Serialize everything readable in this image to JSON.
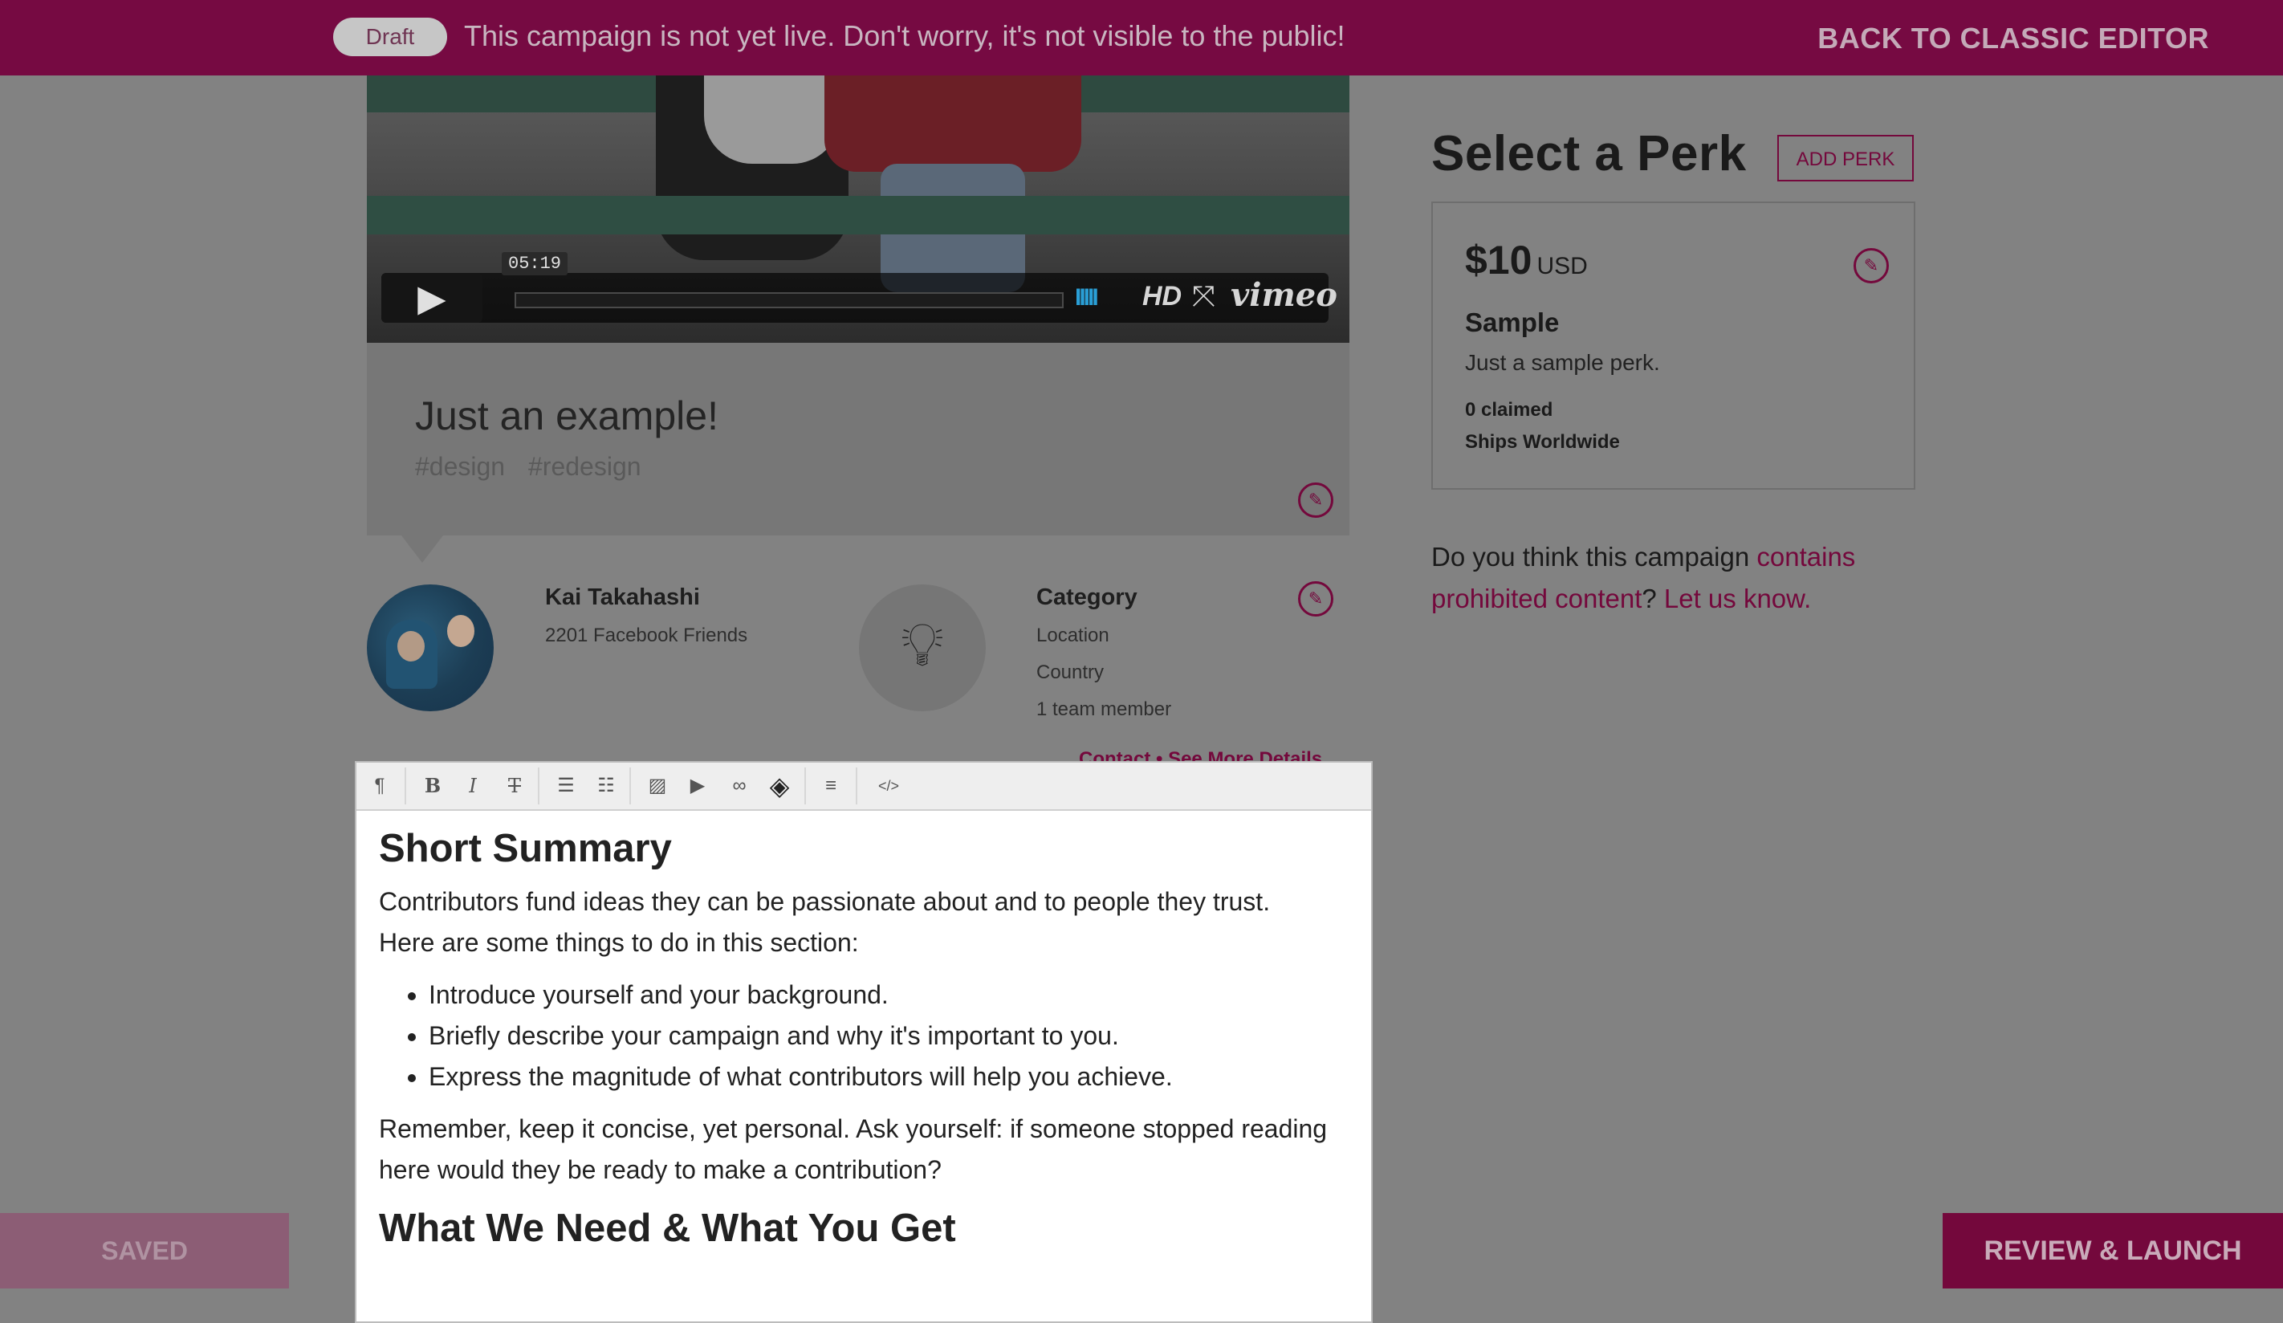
{
  "banner": {
    "status_badge": "Draft",
    "message": "This campaign is not yet live. Don't worry, it's not visible to the public!",
    "classic_editor_label": "BACK TO CLASSIC EDITOR"
  },
  "video": {
    "timecode": "05:19",
    "hd_label": "HD",
    "brand": "vimeo",
    "play_icon": "play-icon",
    "fullscreen_icon": "fullscreen-icon"
  },
  "campaign": {
    "title": "Just an example!",
    "tags": [
      "#design",
      "#redesign"
    ]
  },
  "owner": {
    "name": "Kai Takahashi",
    "friends": "2201 Facebook Friends"
  },
  "category": {
    "label": "Category",
    "location": "Location",
    "country": "Country",
    "team": "1 team member",
    "contact_link": "Contact • See More Details"
  },
  "editor": {
    "toolbar": [
      "paragraph-icon",
      "bold-icon",
      "italic-icon",
      "strikethrough-icon",
      "bulleted-list-icon",
      "numbered-list-icon",
      "image-icon",
      "video-icon",
      "link-icon",
      "clear-format-icon",
      "align-icon",
      "code-icon"
    ],
    "heading1": "Short Summary",
    "para1_line1": "Contributors fund ideas they can be passionate about and to people they trust.",
    "para1_line2": "Here are some things to do in this section:",
    "bullets": [
      "Introduce yourself and your background.",
      "Briefly describe your campaign and why it's important to you.",
      "Express the magnitude of what contributors will help you achieve."
    ],
    "para2": "Remember, keep it concise, yet personal. Ask yourself: if someone stopped reading here would they be ready to make a contribution?",
    "heading2": "What We Need & What You Get"
  },
  "perks": {
    "heading": "Select a Perk",
    "add_label": "ADD PERK",
    "items": [
      {
        "price": "$10",
        "currency": "USD",
        "name": "Sample",
        "description": "Just a sample perk.",
        "claimed": "0 claimed",
        "shipping": "Ships Worldwide"
      }
    ]
  },
  "report": {
    "prefix": "Do you think this campaign ",
    "link1": "contains prohibited content",
    "middle": "? ",
    "link2": "Let us know."
  },
  "footer": {
    "saved_label": "SAVED",
    "launch_label": "REVIEW & LAUNCH"
  },
  "colors": {
    "brand": "#74083c",
    "overlay": "#828282"
  }
}
